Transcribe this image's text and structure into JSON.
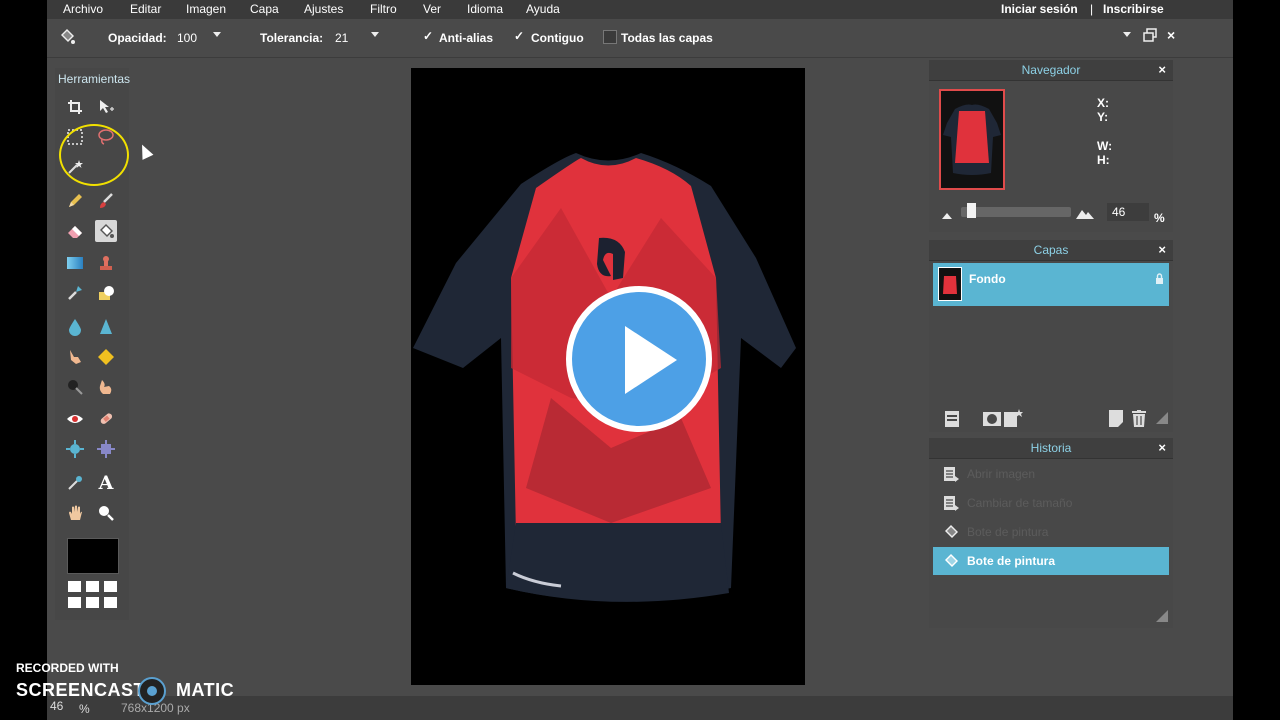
{
  "menu": [
    "Archivo",
    "Editar",
    "Imagen",
    "Capa",
    "Ajustes",
    "Filtro",
    "Ver",
    "Idioma",
    "Ayuda"
  ],
  "auth": {
    "login": "Iniciar sesión",
    "separator": "|",
    "signup": "Inscribirse"
  },
  "toolbar": {
    "opacity_label": "Opacidad:",
    "opacity_value": "100",
    "tolerance_label": "Tolerancia:",
    "tolerance_value": "21",
    "antialias_label": "Anti-alias",
    "antialias_checked": true,
    "contiguous_label": "Contiguo",
    "contiguous_checked": true,
    "all_layers_label": "Todas las capas",
    "all_layers_checked": false,
    "check_mark": "✓"
  },
  "tools": {
    "title": "Herramientas",
    "items": [
      "crop",
      "move",
      "marquee",
      "lasso",
      "magic-wand",
      "pencil",
      "brush",
      "eraser",
      "paint-bucket",
      "gradient",
      "clone-stamp",
      "color-replace",
      "drawing",
      "blur",
      "sharpen",
      "smudge",
      "sponge",
      "dodge",
      "burn",
      "red-eye",
      "spot-heal",
      "bloat",
      "pinch",
      "color-picker",
      "type",
      "hand",
      "zoom"
    ],
    "active": "paint-bucket",
    "type_glyph": "A",
    "foreground_color": "#000000"
  },
  "navigator": {
    "title": "Navegador",
    "close": "×",
    "x_label": "X:",
    "y_label": "Y:",
    "w_label": "W:",
    "h_label": "H:",
    "zoom_value": "46",
    "zoom_unit": "%"
  },
  "layers": {
    "title": "Capas",
    "close": "×",
    "items": [
      {
        "name": "Fondo",
        "locked": true
      }
    ]
  },
  "history": {
    "title": "Historia",
    "close": "×",
    "items": [
      {
        "label": "Abrir imagen",
        "icon": "document-icon",
        "active": false
      },
      {
        "label": "Cambiar de tamaño",
        "icon": "document-icon",
        "active": false
      },
      {
        "label": "Bote de pintura",
        "icon": "paint-bucket-icon",
        "active": false
      },
      {
        "label": "Bote de pintura",
        "icon": "paint-bucket-icon",
        "active": true
      }
    ]
  },
  "status": {
    "zoom": "46",
    "unit": "%",
    "size": "768x1200 px"
  },
  "watermark": {
    "line1": "RECORDED WITH",
    "left": "SCREENCAST",
    "right": "MATIC"
  },
  "colors": {
    "accent": "#5ab5d2",
    "play_button": "#4da0e6",
    "shirt_red": "#e0323c",
    "shirt_dark": "#1f2736",
    "highlight": "#f1e000"
  }
}
